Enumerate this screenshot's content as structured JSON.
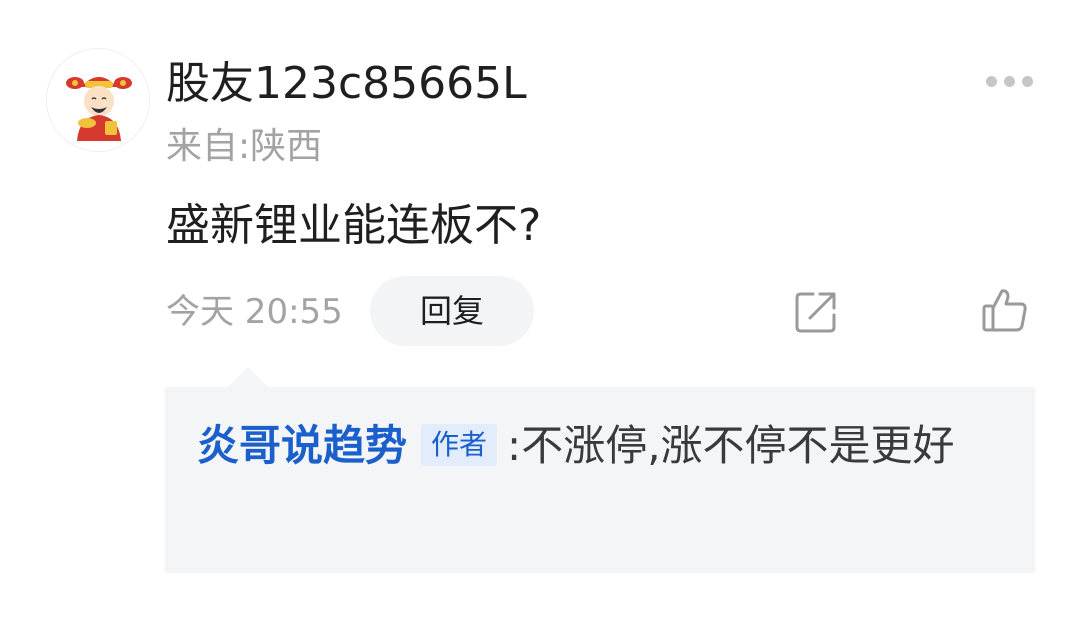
{
  "post": {
    "username": "股友123c85665L",
    "location": "来自:陕西",
    "text": "盛新锂业能连板不?",
    "timestamp": "今天 20:55",
    "reply_label": "回复",
    "icons": {
      "avatar": "avatar-caishen",
      "more": "more-dots-icon",
      "share": "share-icon",
      "like": "thumbs-up-icon"
    }
  },
  "reply": {
    "author": "炎哥说趋势",
    "badge": "作者",
    "colon": ":",
    "text": "不涨停,涨不停不是更好"
  },
  "colors": {
    "author_blue": "#1a5fcc",
    "muted_gray": "#a3a3a3",
    "reply_bg": "#f4f5f7"
  }
}
